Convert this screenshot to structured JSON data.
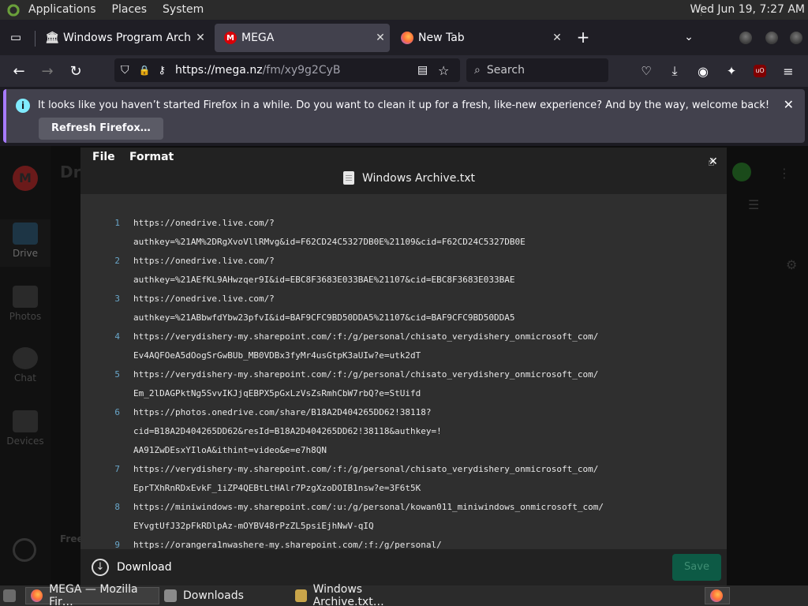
{
  "panel": {
    "applications": "Applications",
    "places": "Places",
    "system": "System",
    "clock": "Wed Jun 19,  7:27 AM"
  },
  "browser": {
    "tabs": [
      {
        "title": "Windows Program Archive",
        "icon": "archive-icon"
      },
      {
        "title": "MEGA",
        "icon": "mega-icon"
      },
      {
        "title": "New Tab",
        "icon": "firefox-icon"
      }
    ],
    "url_domain": "https://mega.nz",
    "url_path": "/fm/xy9g2CyB",
    "search_placeholder": "Search"
  },
  "notification": {
    "message": "It looks like you haven’t started Firefox in a while. Do you want to clean it up for a fresh, like-new experience? And by the way, welcome back!",
    "button": "Refresh Firefox…"
  },
  "mega": {
    "drive_heading": "Dri",
    "sidebar": [
      {
        "label": "Drive"
      },
      {
        "label": "Photos"
      },
      {
        "label": "Chat"
      },
      {
        "label": "Devices"
      }
    ],
    "bg_fragment": "Free"
  },
  "editor": {
    "menu_file": "File",
    "menu_format": "Format",
    "title": "Windows Archive.txt",
    "download": "Download",
    "save": "Save",
    "lines": [
      {
        "num": "1",
        "text": "https://onedrive.live.com/?"
      },
      {
        "num": "",
        "text": "authkey=%21AM%2DRgXvoVllRMvg&id=F62CD24C5327DB0E%21109&cid=F62CD24C5327DB0E"
      },
      {
        "num": "2",
        "text": "https://onedrive.live.com/?"
      },
      {
        "num": "",
        "text": "authkey=%21AEfKL9AHwzqer9I&id=EBC8F3683E033BAE%21107&cid=EBC8F3683E033BAE"
      },
      {
        "num": "3",
        "text": "https://onedrive.live.com/?"
      },
      {
        "num": "",
        "text": "authkey=%21ABbwfdYbw23pfvI&id=BAF9CFC9BD50DDA5%21107&cid=BAF9CFC9BD50DDA5"
      },
      {
        "num": "4",
        "text": "https://verydishery-my.sharepoint.com/:f:/g/personal/chisato_verydishery_onmicrosoft_com/"
      },
      {
        "num": "",
        "text": "Ev4AQFOeA5dOogSrGwBUb_MB0VDBx3fyMr4usGtpK3aUIw?e=utk2dT"
      },
      {
        "num": "5",
        "text": "https://verydishery-my.sharepoint.com/:f:/g/personal/chisato_verydishery_onmicrosoft_com/"
      },
      {
        "num": "",
        "text": "Em_2lDAGPktNg5SvvIKJjqEBPX5pGxLzVsZsRmhCbW7rbQ?e=StUifd"
      },
      {
        "num": "6",
        "text": "https://photos.onedrive.com/share/B18A2D404265DD62!38118?"
      },
      {
        "num": "",
        "text": "cid=B18A2D404265DD62&resId=B18A2D404265DD62!38118&authkey=!"
      },
      {
        "num": "",
        "text": "AA91ZwDEsxYIloA&ithint=video&e=e7h8QN"
      },
      {
        "num": "7",
        "text": "https://verydishery-my.sharepoint.com/:f:/g/personal/chisato_verydishery_onmicrosoft_com/"
      },
      {
        "num": "",
        "text": "EprTXhRnRDxEvkF_1iZP4QEBtLtHAlr7PzgXzoDOIB1nsw?e=3F6t5K"
      },
      {
        "num": "8",
        "text": "https://miniwindows-my.sharepoint.com/:u:/g/personal/kowan011_miniwindows_onmicrosoft_com/"
      },
      {
        "num": "",
        "text": "EYvgtUfJ32pFkRDlpAz-mOYBV48rPzZL5psiEjhNwV-qIQ"
      },
      {
        "num": "9",
        "text": "https://orangera1nwashere-my.sharepoint.com/:f:/g/personal/"
      }
    ]
  },
  "taskbar": {
    "items": [
      {
        "label": "MEGA — Mozilla Fir…"
      },
      {
        "label": "Downloads"
      },
      {
        "label": "Windows Archive.txt…"
      }
    ]
  },
  "colors": {
    "accent_purple": "#a77bff",
    "info_blue": "#80ebff",
    "save_green": "#0d5a45",
    "line_number": "#69a6c9"
  }
}
